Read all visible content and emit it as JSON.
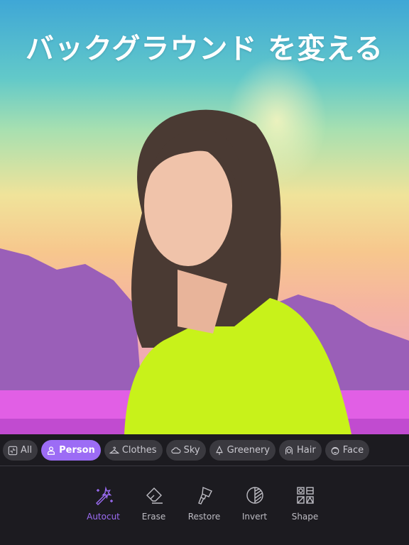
{
  "title": "バックグラウンド を変える",
  "colors": {
    "accent": "#9c6cf5",
    "chip_bg": "#3a393f",
    "panel_bg": "#1c1b20"
  },
  "categories": [
    {
      "label": "All",
      "icon": "all-segment-icon"
    },
    {
      "label": "Person",
      "icon": "person-icon",
      "active": true
    },
    {
      "label": "Clothes",
      "icon": "hanger-icon"
    },
    {
      "label": "Sky",
      "icon": "cloud-icon"
    },
    {
      "label": "Greenery",
      "icon": "tree-icon"
    },
    {
      "label": "Hair",
      "icon": "hair-icon"
    },
    {
      "label": "Face",
      "icon": "face-icon"
    }
  ],
  "tools": [
    {
      "label": "Autocut",
      "icon": "magic-wand-icon",
      "active": true
    },
    {
      "label": "Erase",
      "icon": "eraser-icon"
    },
    {
      "label": "Restore",
      "icon": "brush-icon"
    },
    {
      "label": "Invert",
      "icon": "invert-icon"
    },
    {
      "label": "Shape",
      "icon": "shape-icon"
    }
  ]
}
